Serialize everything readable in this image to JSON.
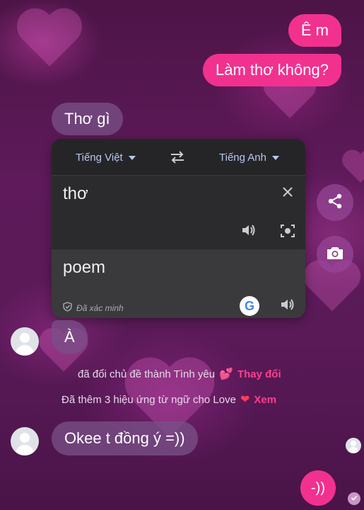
{
  "messages": {
    "outgoing_1": "Ê m",
    "outgoing_2": "Làm thơ không?",
    "incoming_1": "Thơ gì",
    "incoming_2": "À",
    "incoming_3": "Okee t đồng ý =))",
    "outgoing_3": "-))"
  },
  "translate_popup": {
    "source_lang": "Tiếng Việt",
    "target_lang": "Tiếng Anh",
    "source_text": "thơ",
    "translated_text": "poem",
    "verified_label": "Đã xác minh",
    "google_letter": "G"
  },
  "notices": {
    "theme_text": "đã đổi chủ đề thành Tình yêu",
    "theme_action": "Thay đổi",
    "effects_text": "Đã thêm 3 hiệu ứng từ ngữ cho Love",
    "effects_action": "Xem"
  },
  "colors": {
    "outgoing_bubble": "#f2318f",
    "incoming_bubble": "#785087",
    "accent_action": "#ff3f8e"
  },
  "icons": [
    "share-icon",
    "camera-icon",
    "close-icon",
    "speaker-icon",
    "lens-icon",
    "swap-icon",
    "shield-check-icon",
    "heart-icon",
    "check-icon"
  ]
}
